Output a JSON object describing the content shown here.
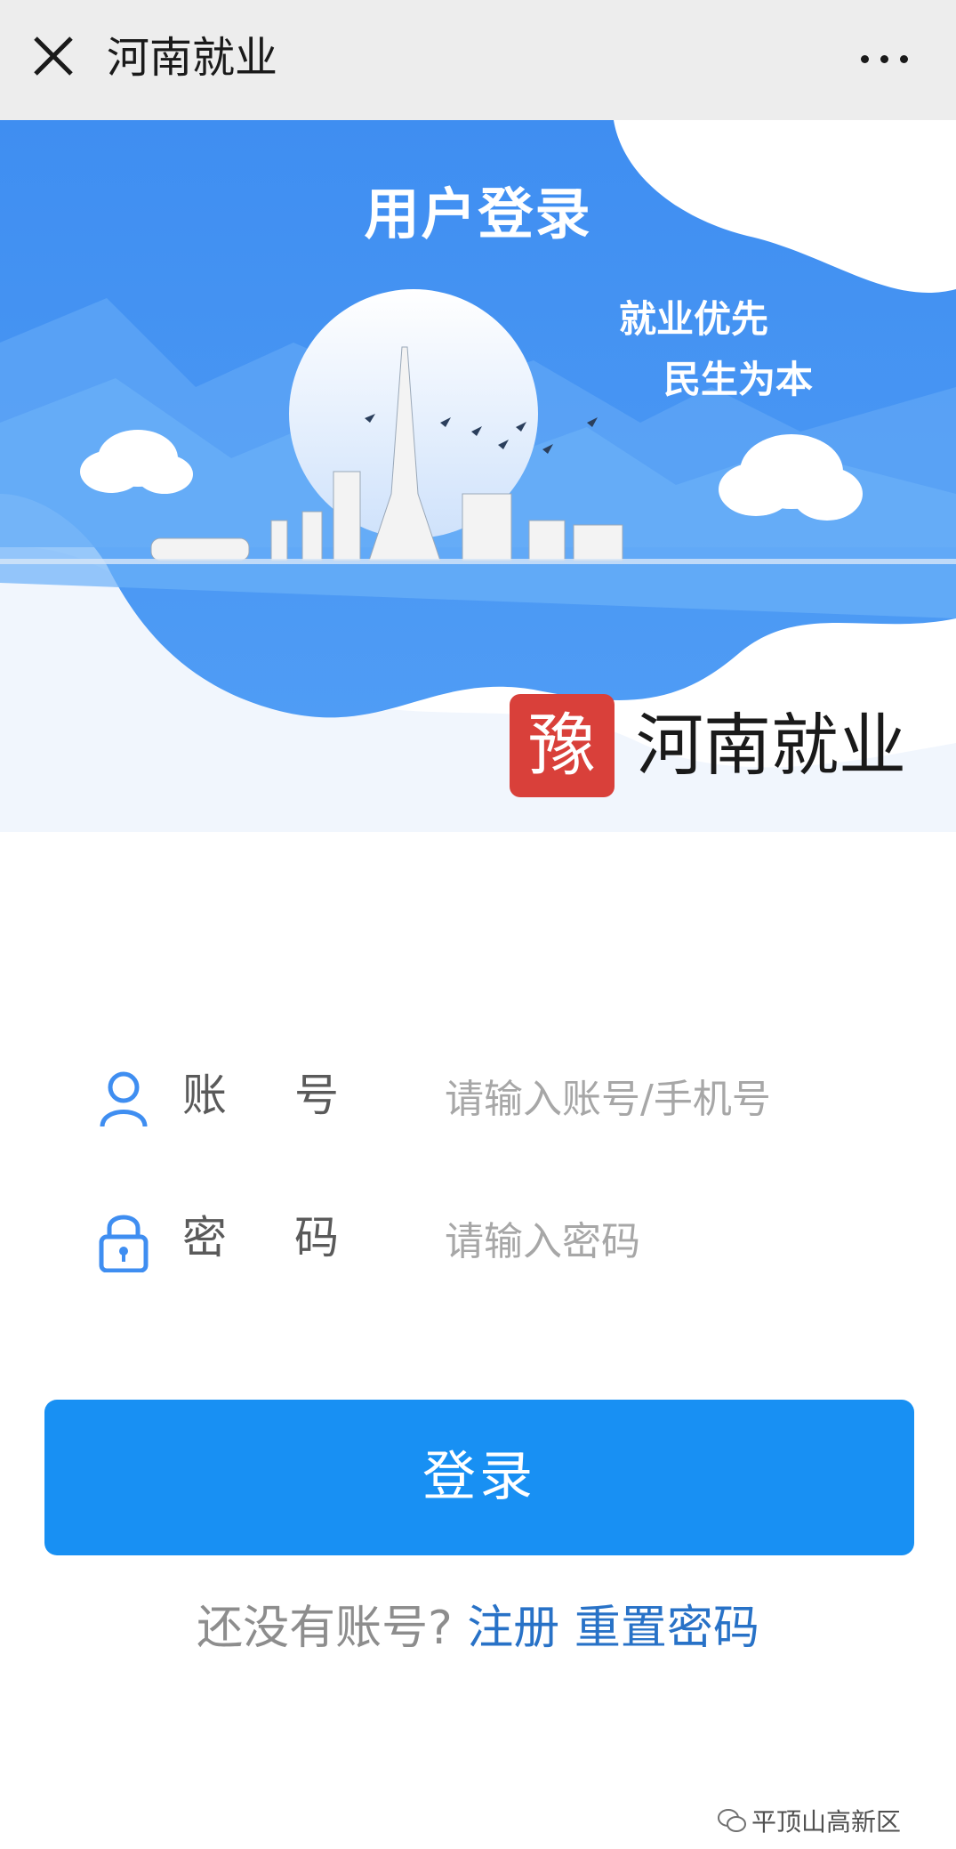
{
  "topbar": {
    "title": "河南就业",
    "close_icon": "close-icon",
    "more_icon": "more-icon"
  },
  "banner": {
    "title": "用户登录",
    "slogan_line1": "就业优先",
    "slogan_line2": "民生为本",
    "colors": {
      "primary_blue": "#3d8cf0",
      "dark_blue": "#2c6fde",
      "pale_blue": "#e8f0fb"
    }
  },
  "brand": {
    "seal_char": "豫",
    "name": "河南就业",
    "seal_color": "#d9403a"
  },
  "form": {
    "account_label": "账号",
    "account_placeholder": "请输入账号/手机号",
    "account_icon": "user-icon",
    "password_label": "密码",
    "password_placeholder": "请输入密码",
    "password_icon": "lock-icon"
  },
  "login_button": {
    "label": "登录",
    "color": "#1890f3"
  },
  "footer": {
    "no_account_text": "还没有账号?",
    "register_link": "注册",
    "reset_link": "重置密码"
  },
  "watermark": {
    "text": "平顶山高新区",
    "icon": "wechat-icon"
  }
}
